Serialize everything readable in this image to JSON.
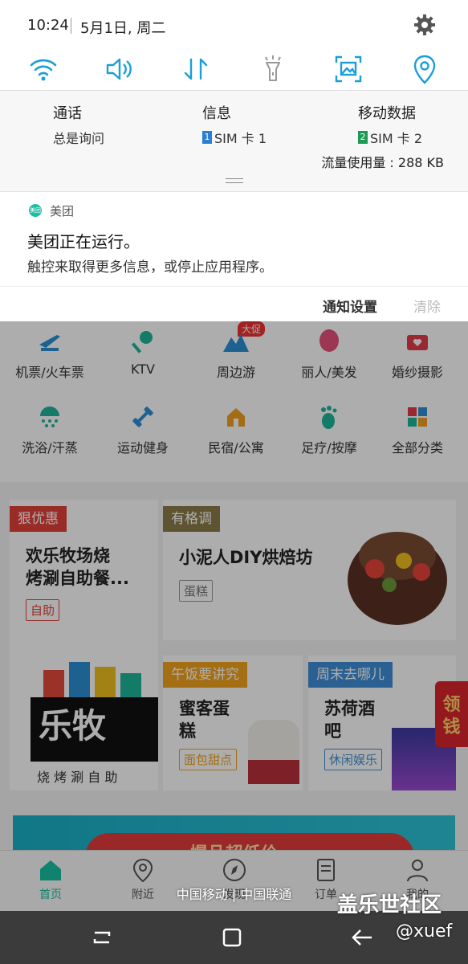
{
  "status": {
    "time": "10:24",
    "date": "5月1日, 周二"
  },
  "quick_settings": [
    "wifi-icon",
    "sound-icon",
    "data-transfer-icon",
    "flashlight-icon",
    "screen-capture-icon",
    "location-icon"
  ],
  "sim": {
    "call": {
      "label": "通话",
      "value": "总是询问"
    },
    "message": {
      "label": "信息",
      "badge": "1",
      "value": "SIM 卡 1"
    },
    "mobile_data": {
      "label": "移动数据",
      "badge": "2",
      "value": "SIM 卡 2"
    },
    "data_usage": "流量使用量 : 288 KB"
  },
  "notification": {
    "app_name": "美团",
    "app_icon_text": "美团",
    "title": "美团正在运行。",
    "body": "触控来取得更多信息，或停止应用程序。",
    "settings_button": "通知设置",
    "clear_button": "清除"
  },
  "app": {
    "promo_badge": "大促",
    "categories_row1": [
      "机票/火车票",
      "KTV",
      "周边游",
      "丽人/美发",
      "婚纱摄影"
    ],
    "categories_row2": [
      "洗浴/汗蒸",
      "运动健身",
      "民宿/公寓",
      "足疗/按摩",
      "全部分类"
    ],
    "cards": {
      "deal": {
        "tag": "狠优惠",
        "title": "欢乐牧场烧\n烤涮自助餐...",
        "chip": "自助",
        "logo_text": "乐牧",
        "logo_sub": "烧 烤 涮 自 助"
      },
      "featured": {
        "tag": "有格调",
        "title": "小泥人DIY烘焙坊",
        "chip": "蛋糕"
      },
      "lunch": {
        "tag": "午饭要讲究",
        "title": "蜜客蛋\n糕",
        "chip": "面包甜点"
      },
      "weekend": {
        "tag": "周末去哪儿",
        "title": "苏荷酒\n吧",
        "chip": "休闲娱乐"
      },
      "red_packet": "领\n钱"
    },
    "banner_text": "爆品超低价",
    "bottom_nav": [
      "首页",
      "附近",
      "发现",
      "订单",
      "我的"
    ]
  },
  "carrier": "中国移动 | 中国联通",
  "watermark": {
    "line1": "盖乐世社区",
    "line2": "@xuef"
  },
  "colors": {
    "accent": "#1a9fd9",
    "meituan": "#19c0a3",
    "tag_red": "#e3423a",
    "tag_olive": "#8c7c4a",
    "tag_orange": "#f2a31c",
    "tag_blue": "#3f8fd8"
  }
}
